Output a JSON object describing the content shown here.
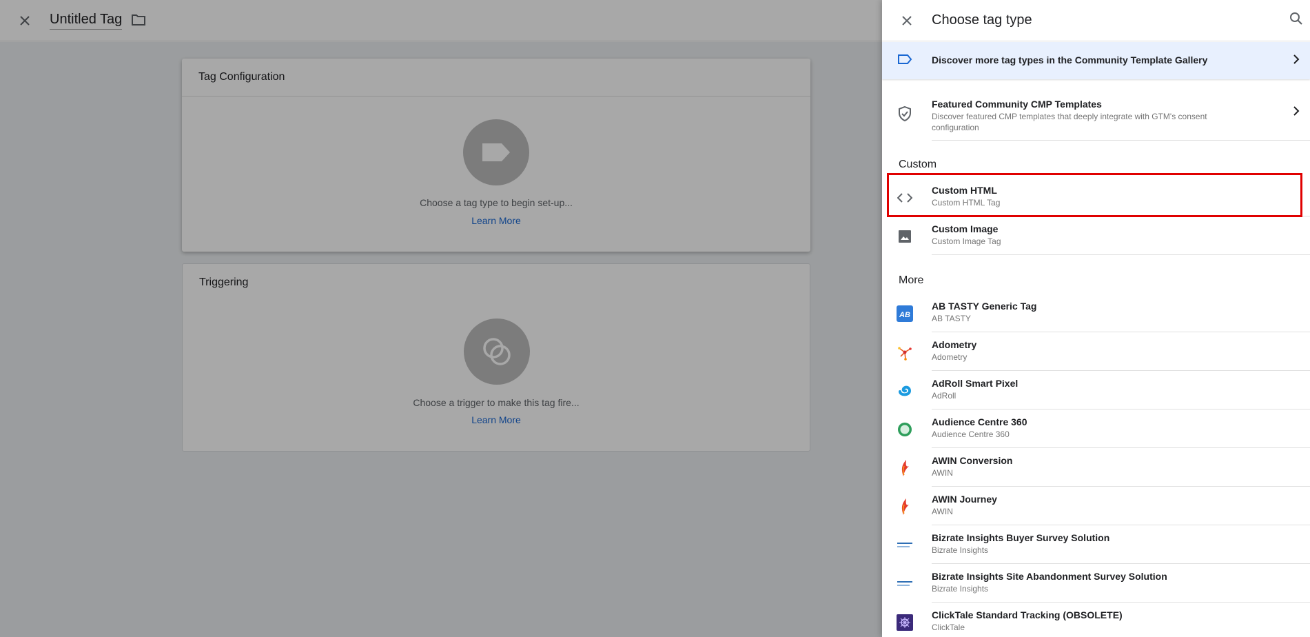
{
  "editor": {
    "tag_name": "Untitled Tag",
    "config_card": {
      "title": "Tag Configuration",
      "hint": "Choose a tag type to begin set-up...",
      "link": "Learn More"
    },
    "trigger_card": {
      "title": "Triggering",
      "hint": "Choose a trigger to make this tag fire...",
      "link": "Learn More"
    }
  },
  "panel": {
    "title": "Choose tag type",
    "community_bar": "Discover more tag types in the Community Template Gallery",
    "cmp": {
      "name": "Featured Community CMP Templates",
      "description": "Discover featured CMP templates that deeply integrate with GTM's consent configuration"
    },
    "section_custom": "Custom",
    "custom_items": [
      {
        "name": "Custom HTML",
        "sub": "Custom HTML Tag",
        "icon": "code-icon"
      },
      {
        "name": "Custom Image",
        "sub": "Custom Image Tag",
        "icon": "image-icon"
      }
    ],
    "section_more": "More",
    "more_items": [
      {
        "name": "AB TASTY Generic Tag",
        "sub": "AB TASTY",
        "icon": "ab-tasty-logo-icon"
      },
      {
        "name": "Adometry",
        "sub": "Adometry",
        "icon": "adometry-logo-icon"
      },
      {
        "name": "AdRoll Smart Pixel",
        "sub": "AdRoll",
        "icon": "adroll-logo-icon"
      },
      {
        "name": "Audience Centre 360",
        "sub": "Audience Centre 360",
        "icon": "audience-centre-logo-icon"
      },
      {
        "name": "AWIN Conversion",
        "sub": "AWIN",
        "icon": "awin-logo-icon"
      },
      {
        "name": "AWIN Journey",
        "sub": "AWIN",
        "icon": "awin-logo-icon"
      },
      {
        "name": "Bizrate Insights Buyer Survey Solution",
        "sub": "Bizrate Insights",
        "icon": "bizrate-logo-icon"
      },
      {
        "name": "Bizrate Insights Site Abandonment Survey Solution",
        "sub": "Bizrate Insights",
        "icon": "bizrate-logo-icon"
      },
      {
        "name": "ClickTale Standard Tracking (OBSOLETE)",
        "sub": "ClickTale",
        "icon": "clicktale-logo-icon"
      }
    ]
  },
  "colors": {
    "accent_blue": "#1967d2",
    "highlight_red": "#e00000",
    "community_bar_bg": "#e8f0fe"
  }
}
